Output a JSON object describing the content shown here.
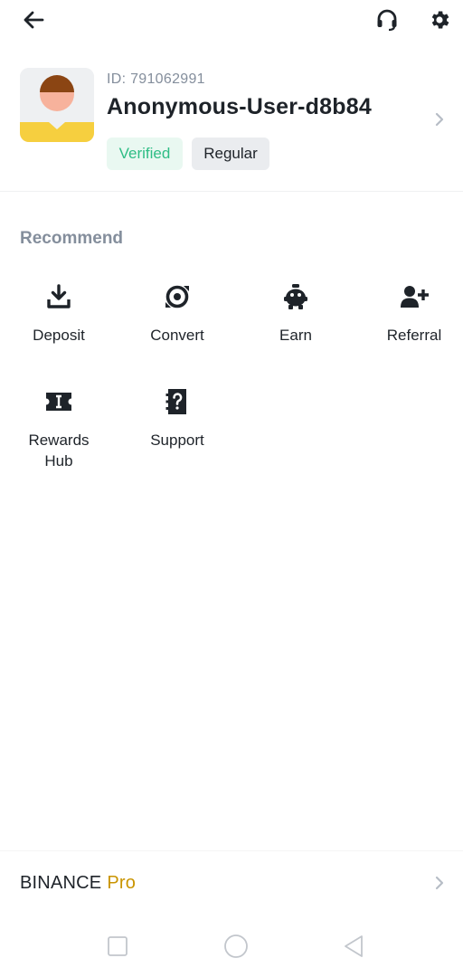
{
  "header": {
    "icons": [
      "back-arrow-icon",
      "headset-icon",
      "gear-icon"
    ]
  },
  "profile": {
    "user_id": "ID: 791062991",
    "username": "Anonymous-User-d8b84",
    "verified_label": "Verified",
    "tier_label": "Regular"
  },
  "recommend": {
    "title": "Recommend",
    "items": [
      {
        "label": "Deposit",
        "icon": "download-icon"
      },
      {
        "label": "Convert",
        "icon": "convert-icon"
      },
      {
        "label": "Earn",
        "icon": "piggy-bank-icon"
      },
      {
        "label": "Referral",
        "icon": "add-user-icon"
      },
      {
        "label": "Rewards Hub",
        "icon": "ticket-icon"
      },
      {
        "label": "Support",
        "icon": "question-doc-icon"
      }
    ]
  },
  "pro": {
    "brand": "BINANCE",
    "suffix": "Pro"
  },
  "colors": {
    "text": "#1e2329",
    "muted": "#848e9c",
    "verified_green": "#2ebd85",
    "pro_gold": "#c99400"
  }
}
